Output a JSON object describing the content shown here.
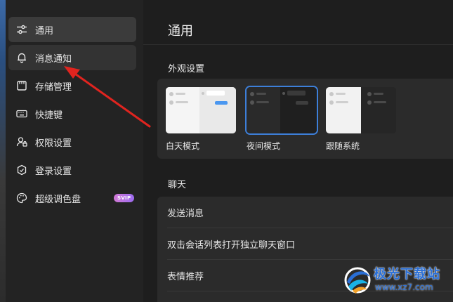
{
  "sidebar": {
    "items": [
      {
        "label": "通用",
        "icon": "sliders-icon",
        "state": "active"
      },
      {
        "label": "消息通知",
        "icon": "bell-icon",
        "state": "hover"
      },
      {
        "label": "存储管理",
        "icon": "storage-icon",
        "state": ""
      },
      {
        "label": "快捷键",
        "icon": "keyboard-icon",
        "state": ""
      },
      {
        "label": "权限设置",
        "icon": "user-lock-icon",
        "state": ""
      },
      {
        "label": "登录设置",
        "icon": "shield-icon",
        "state": ""
      },
      {
        "label": "超级调色盘",
        "icon": "palette-icon",
        "state": "",
        "badge": "SVIP"
      }
    ]
  },
  "main": {
    "title": "通用",
    "appearance": {
      "section_title": "外观设置",
      "options": [
        {
          "label": "白天模式",
          "theme": "light",
          "selected": false
        },
        {
          "label": "夜间模式",
          "theme": "dark",
          "selected": true
        },
        {
          "label": "跟随系统",
          "theme": "system",
          "selected": false
        }
      ]
    },
    "chat": {
      "section_title": "聊天",
      "rows": [
        {
          "label": "发送消息"
        },
        {
          "label": "双击会话列表打开独立聊天窗口"
        },
        {
          "label": "表情推荐"
        }
      ]
    }
  },
  "watermark": {
    "name": "极光下载站",
    "url": "www.xz7.com"
  },
  "colors": {
    "accent": "#3d7fd9",
    "annotation": "#e0241f",
    "sidebar_bg": "#232323",
    "main_bg": "#1e1e1e",
    "card_bg": "#2b2b2b",
    "svip_gradient_start": "#d37ad6",
    "svip_gradient_end": "#9b6bf0",
    "watermark": "#2a6fd6"
  }
}
